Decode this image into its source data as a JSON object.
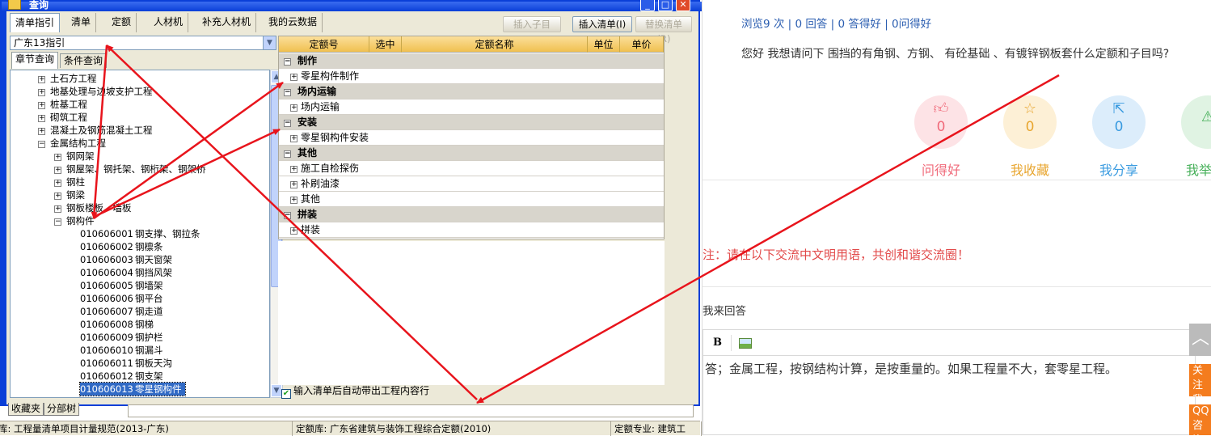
{
  "window": {
    "title": "查询",
    "controls": [
      "_",
      "□",
      "✕"
    ]
  },
  "tabs": [
    "清单指引",
    "清单",
    "定额",
    "人材机",
    "补充人材机",
    "我的云数据"
  ],
  "toolbar": {
    "insert_child": "插入子目",
    "insert_list": "插入清单(I)",
    "replace_list": "替换清单(R)"
  },
  "combo": {
    "value": "广东13指引"
  },
  "subtabs": [
    "章节查询",
    "条件查询"
  ],
  "tree": {
    "groups": [
      {
        "label": "土石方工程",
        "state": "+"
      },
      {
        "label": "地基处理与边坡支护工程",
        "state": "+"
      },
      {
        "label": "桩基工程",
        "state": "+"
      },
      {
        "label": "砌筑工程",
        "state": "+"
      },
      {
        "label": "混凝土及钢筋混凝土工程",
        "state": "+"
      },
      {
        "label": "金属结构工程",
        "state": "-"
      }
    ],
    "sub": [
      {
        "label": "钢网架",
        "state": "+"
      },
      {
        "label": "钢屋架、钢托架、钢桁架、钢架桥",
        "state": "+"
      },
      {
        "label": "钢柱",
        "state": "+"
      },
      {
        "label": "钢梁",
        "state": "+"
      },
      {
        "label": "钢板楼板、墙板",
        "state": "+"
      },
      {
        "label": "钢构件",
        "state": "-"
      }
    ],
    "leaves": [
      {
        "code": "010606001",
        "name": "钢支撑、钢拉条"
      },
      {
        "code": "010606002",
        "name": "钢檩条"
      },
      {
        "code": "010606003",
        "name": "钢天窗架"
      },
      {
        "code": "010606004",
        "name": "钢挡风架"
      },
      {
        "code": "010606005",
        "name": "钢墙架"
      },
      {
        "code": "010606006",
        "name": "钢平台"
      },
      {
        "code": "010606007",
        "name": "钢走道"
      },
      {
        "code": "010606008",
        "name": "钢梯"
      },
      {
        "code": "010606009",
        "name": "钢护栏"
      },
      {
        "code": "010606010",
        "name": "钢漏斗"
      },
      {
        "code": "010606011",
        "name": "钢板天沟"
      },
      {
        "code": "010606012",
        "name": "钢支架"
      },
      {
        "code": "010606013",
        "name": "零星钢构件"
      }
    ]
  },
  "grid": {
    "headers": [
      "定额号",
      "选中",
      "定额名称",
      "单位",
      "单价"
    ],
    "rows": [
      {
        "type": "group",
        "label": "制作"
      },
      {
        "type": "child",
        "label": "零星构件制作"
      },
      {
        "type": "group",
        "label": "场内运输"
      },
      {
        "type": "child",
        "label": "场内运输"
      },
      {
        "type": "group",
        "label": "安装"
      },
      {
        "type": "child",
        "label": "零星钢构件安装"
      },
      {
        "type": "group",
        "label": "其他"
      },
      {
        "type": "child",
        "label": "施工自检探伤"
      },
      {
        "type": "child",
        "label": "补刷油漆"
      },
      {
        "type": "child",
        "label": "其他"
      },
      {
        "type": "group",
        "label": "拼装"
      },
      {
        "type": "child",
        "label": "拼装"
      }
    ]
  },
  "checkbox": {
    "label": "输入清单后自动带出工程内容行",
    "checked": true
  },
  "bottom_tabs": [
    "收藏夹",
    "分部树"
  ],
  "status": [
    "库: 工程量清单项目计量规范(2013-广东)",
    "定额库: 广东省建筑与装饰工程综合定额(2010)",
    "定额专业: 建筑工"
  ],
  "web": {
    "stats": "浏览9 次 | 0 回答 | 0 答得好 | 0问得好",
    "question": "您好 我想请问下 围挡的有角钢、方钢、 有砼基础 、有镀锌钢板套什么定额和子目吗?",
    "actions": [
      {
        "icon": "thumb-up-icon",
        "count": "0",
        "label": "问得好",
        "color": "#f06a7a",
        "bg": "#fde3e6"
      },
      {
        "icon": "star-icon",
        "count": "0",
        "label": "我收藏",
        "color": "#e8a630",
        "bg": "#fdf0d6"
      },
      {
        "icon": "share-icon",
        "count": "0",
        "label": "我分享",
        "color": "#3a9be0",
        "bg": "#dcedfb"
      },
      {
        "icon": "warning-icon",
        "count": "",
        "label": "我举",
        "color": "#47b05a",
        "bg": "#e0f3e3"
      }
    ],
    "notice": "注：请在以下交流中文明用语，共创和谐交流圈！",
    "my_answer_label": "我来回答",
    "editor_bold": "B",
    "answer_text": "答；金属工程，按钢结构计算，是按重量的。如果工程量不大，套零星工程。",
    "side_top": "︿",
    "side_follow": "关注我们",
    "side_qq": "QQ咨询"
  },
  "colors": {
    "annotation_arrow": "#e8141c",
    "window_blue": "#0a3fd8",
    "grid_header": "#f0c050"
  }
}
